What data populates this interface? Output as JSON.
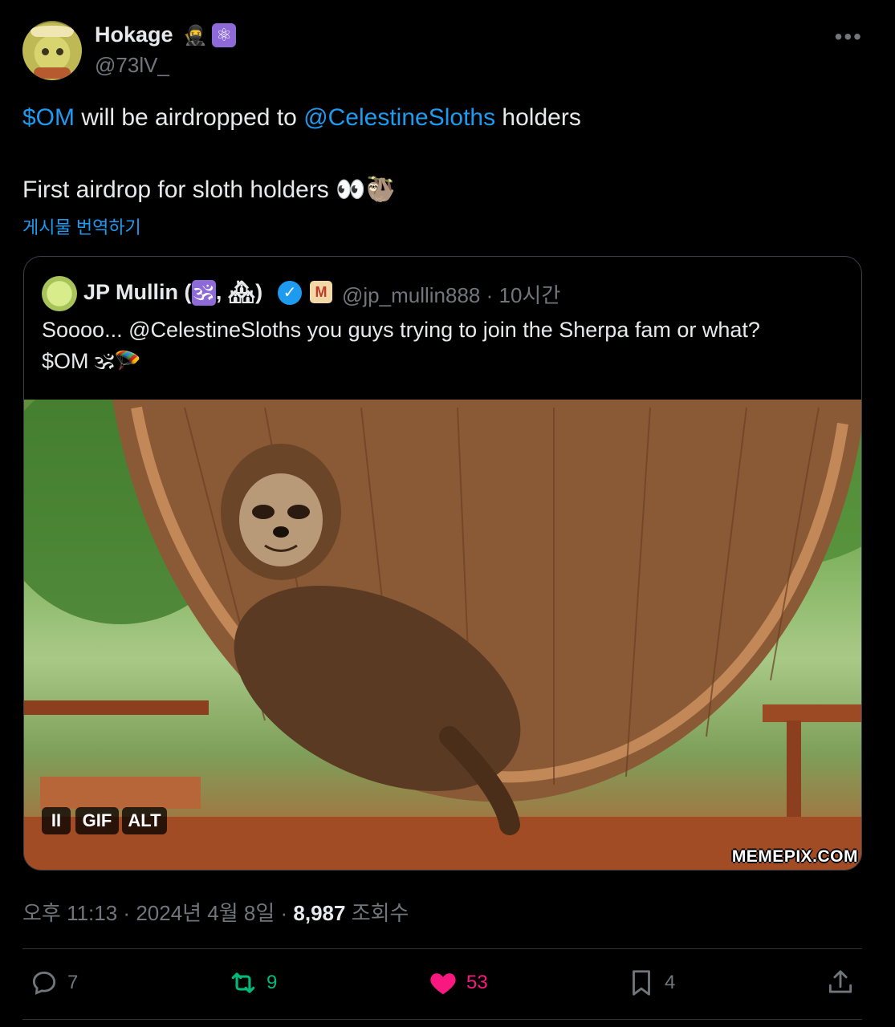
{
  "author": {
    "name": "Hokage",
    "handle": "@73lV_",
    "badge_icons": [
      "ninja-emoji-icon",
      "atom-emoji-icon"
    ]
  },
  "tweet": {
    "line1_prefix": "$OM",
    "line1_mid": " will be airdropped to ",
    "line1_mention": "@CelestineSloths",
    "line1_suffix": " holders",
    "line2": "First airdrop for sloth holders",
    "line2_emojis": "👀🦥",
    "translate_label": "게시물 번역하기"
  },
  "quoted": {
    "name": "JP Mullin (",
    "name_om": "🕉",
    "name_mid": ", ",
    "name_house": "🏘",
    "name_end": ")",
    "handle": "@jp_mullin888",
    "time": "· 10시간",
    "text_line1": "Soooo... @CelestineSloths you guys trying to join the Sherpa fam or what?",
    "text_line2": "$OM",
    "text_line2_emojis": "🕉🪂",
    "media": {
      "pause_label": "II",
      "gif_label": "GIF",
      "alt_label": "ALT",
      "watermark": "MEMEPIX.COM"
    }
  },
  "meta": {
    "time": "오후 11:13",
    "date": "2024년 4월 8일",
    "separator": " · ",
    "views": "8,987",
    "views_label": "조회수"
  },
  "actions": {
    "reply_count": "7",
    "retweet_count": "9",
    "like_count": "53",
    "bookmark_count": "4"
  },
  "colors": {
    "background": "#000000",
    "text": "#e7e9ea",
    "muted": "#71767b",
    "link": "#1d9bf0",
    "retweet": "#00ba7c",
    "like": "#f91880"
  }
}
